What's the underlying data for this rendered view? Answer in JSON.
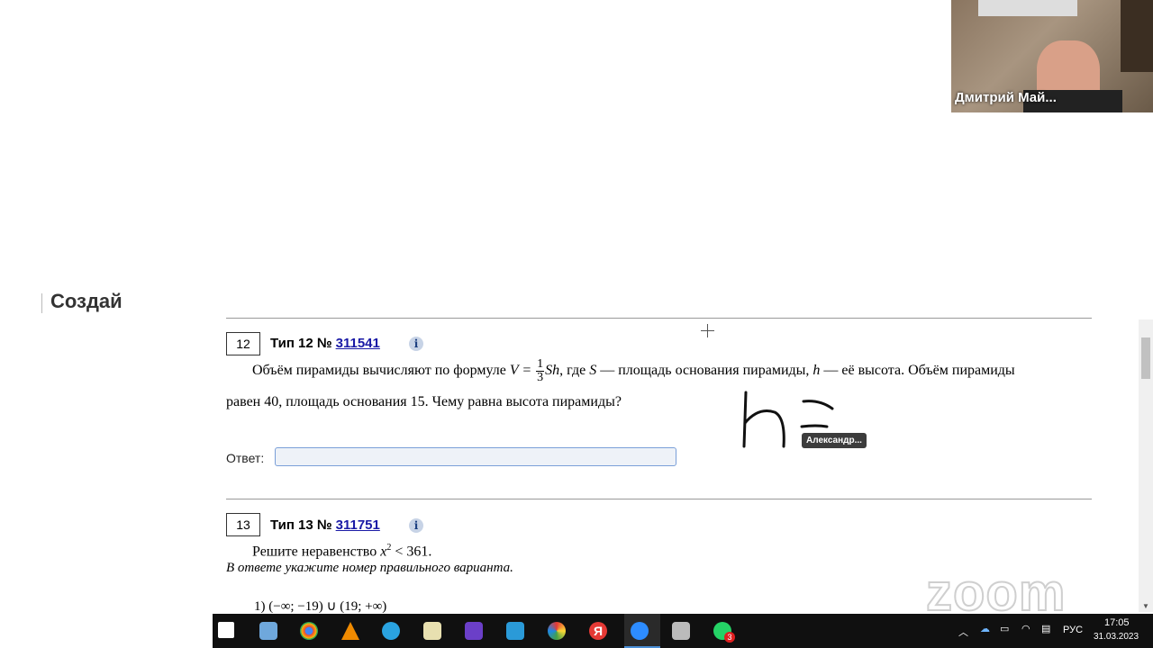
{
  "sidebar": {
    "heading": "Создай"
  },
  "questions": [
    {
      "number": "12",
      "type_label": "Тип 12 №",
      "id": "311541",
      "info_icon": "i",
      "text_before_formula": "Объём пирамиды вычисляют по формуле",
      "formula_lhs": "V =",
      "formula_num": "1",
      "formula_den": "3",
      "formula_rhs": "Sh",
      "text_mid_1": ", где",
      "var_S": "S",
      "text_mid_2": "— площадь основания пирамиды,",
      "var_h": "h",
      "text_mid_3": "— её высота. Объём пирамиды",
      "line2": "равен 40, площадь основания 15. Чему равна высота пирамиды?",
      "answer_label": "Ответ:",
      "answer_value": ""
    },
    {
      "number": "13",
      "type_label": "Тип 13 №",
      "id": "311751",
      "info_icon": "i",
      "text_intro": "Решите неравенство",
      "inequality_var": "x",
      "inequality_exp": "2",
      "inequality_rest": "< 361.",
      "note": "В ответе укажите номер правильного варианта.",
      "option1": "1)  (−∞; −19) ∪ (19; +∞)"
    }
  ],
  "annotation": {
    "tooltip": "Александр..."
  },
  "video": {
    "participant_name": "Дмитрий Май..."
  },
  "watermark": "zoom",
  "taskbar": {
    "icons": [
      "windows-start-icon",
      "explorer-icon",
      "chrome-icon",
      "vlc-icon",
      "telegram-icon",
      "draw-icon",
      "pen-app-icon",
      "camera-app-icon",
      "color-app-icon",
      "yandex-icon",
      "zoom-icon",
      "stack-app-icon",
      "whatsapp-icon"
    ],
    "whatsapp_badge": "3",
    "language": "РУС",
    "time": "17:05",
    "date": "31.03.2023"
  },
  "colors": {
    "link": "#1a1aa6",
    "input_border": "#7a9fd8",
    "taskbar": "#101010"
  }
}
